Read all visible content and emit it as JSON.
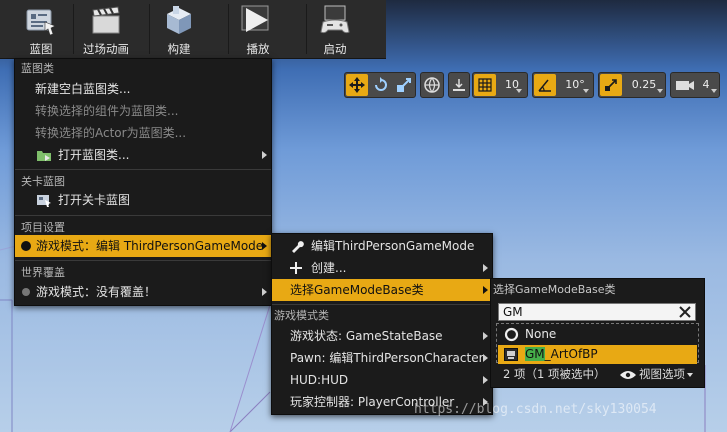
{
  "toolbar": {
    "blueprints": {
      "label": "蓝图",
      "icon": "blueprint-icon"
    },
    "cinematics": {
      "label": "过场动画",
      "icon": "clapperboard-icon"
    },
    "build": {
      "label": "构建",
      "icon": "build-cube-icon"
    },
    "play": {
      "label": "播放",
      "icon": "play-icon"
    },
    "launch": {
      "label": "启动",
      "icon": "gamepad-icon"
    }
  },
  "viewport_toolbar": {
    "grid_snap_value": "10",
    "rotation_snap_value": "10°",
    "scale_snap_value": "0.25",
    "camera_speed_value": "4",
    "accent_color": "#e8a914"
  },
  "blueprint_menu": {
    "section_blueprint_classes": "蓝图类",
    "new_empty_blueprint": "新建空白蓝图类...",
    "convert_selected_components": "转换选择的组件为蓝图类...",
    "convert_selected_actors": "转换选择的Actor为蓝图类...",
    "open_blueprint_class": "打开蓝图类...",
    "section_level_blueprint": "关卡蓝图",
    "open_level_blueprint": "打开关卡蓝图",
    "section_project_settings": "项目设置",
    "game_mode_edit": "游戏模式：编辑 ThirdPersonGameMode",
    "section_world_override": "世界覆盖",
    "game_mode_no_override": "游戏模式：没有覆盖！"
  },
  "gamemode_submenu": {
    "edit_game_mode": "编辑ThirdPersonGameMode",
    "create": "创建...",
    "select_base_class": "选择GameModeBase类",
    "section_game_mode_classes": "游戏模式类",
    "game_state": "游戏状态: GameStateBase",
    "pawn": "Pawn: 编辑ThirdPersonCharacter",
    "hud": "HUD:HUD",
    "player_controller": "玩家控制器: PlayerController"
  },
  "class_picker": {
    "title": "选择GameModeBase类",
    "search_value": "GM",
    "items": [
      {
        "label": "None"
      },
      {
        "label_match": "GM",
        "label_rest": "_ArtOfBP"
      }
    ],
    "count_text": "2 项（1 项被选中）",
    "view_options": "视图选项"
  },
  "watermark": "https://blog.csdn.net/sky130054"
}
